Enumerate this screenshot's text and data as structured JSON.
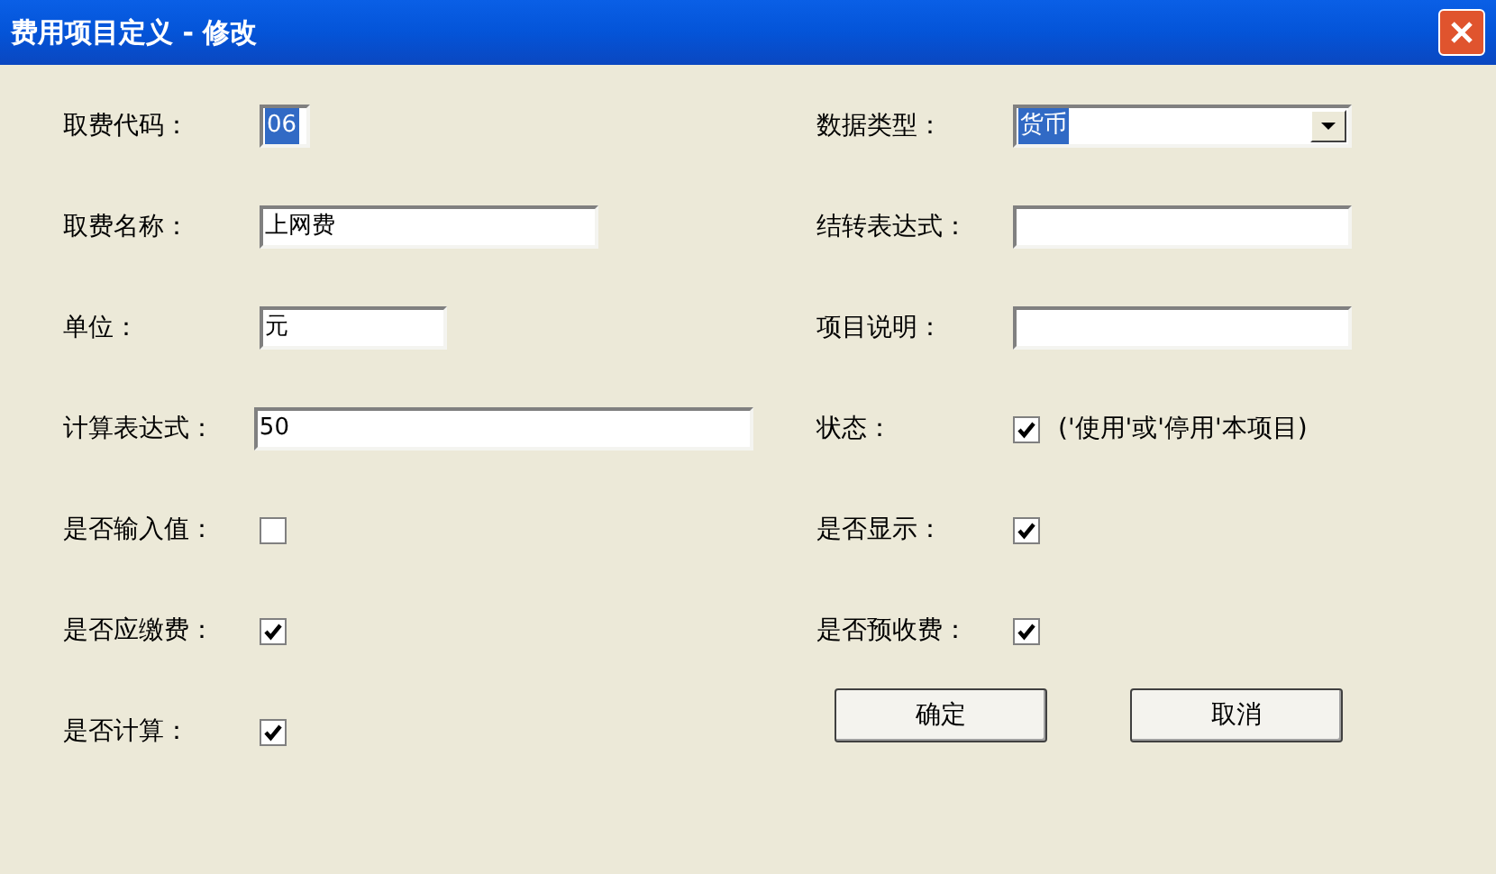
{
  "window": {
    "title": "费用项目定义 - 修改"
  },
  "left_fields": [
    {
      "label": "取费代码：",
      "kind": "text",
      "value": "06",
      "highlighted": true
    },
    {
      "label": "取费名称：",
      "kind": "text",
      "value": "上网费",
      "highlighted": false
    },
    {
      "label": "单位：",
      "kind": "text",
      "value": "元",
      "highlighted": false
    },
    {
      "label": "计算表达式：",
      "kind": "text",
      "value": "50",
      "highlighted": false
    },
    {
      "label": "是否输入值：",
      "kind": "checkbox",
      "checked": false
    },
    {
      "label": "是否应缴费：",
      "kind": "checkbox",
      "checked": true
    },
    {
      "label": "是否计算：",
      "kind": "checkbox",
      "checked": true
    }
  ],
  "right_fields": [
    {
      "label": "数据类型：",
      "kind": "select",
      "value": "货币",
      "highlighted": true
    },
    {
      "label": "结转表达式：",
      "kind": "text"
    },
    {
      "label": "项目说明：",
      "kind": "text"
    },
    {
      "label": "状态：",
      "kind": "checkbox",
      "checked": true,
      "note": "('使用'或'停用'本项目)"
    },
    {
      "label": "是否显示：",
      "kind": "checkbox",
      "checked": true
    },
    {
      "label": "是否预收费：",
      "kind": "checkbox",
      "checked": true
    }
  ],
  "buttons": [
    "确定",
    "取消"
  ]
}
